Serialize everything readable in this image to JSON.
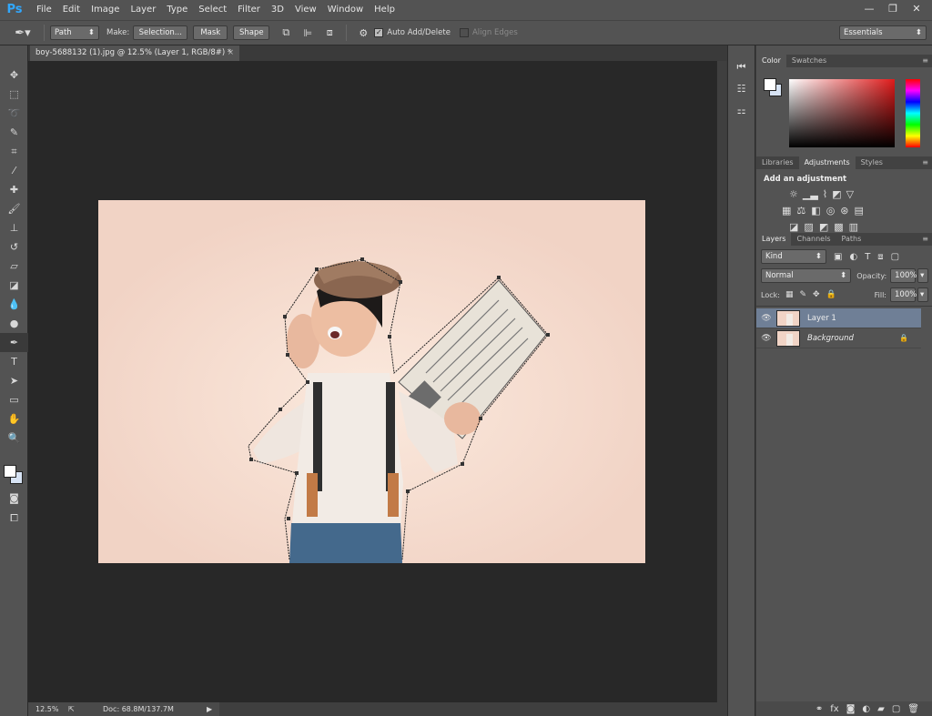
{
  "app": {
    "logo": "Ps"
  },
  "menu": [
    "File",
    "Edit",
    "Image",
    "Layer",
    "Type",
    "Select",
    "Filter",
    "3D",
    "View",
    "Window",
    "Help"
  ],
  "window_controls": [
    "—",
    "❐",
    "✕"
  ],
  "options": {
    "mode": "Path",
    "make_label": "Make:",
    "selection_btn": "Selection...",
    "mask_btn": "Mask",
    "shape_btn": "Shape",
    "auto_add_delete": "Auto Add/Delete",
    "align_edges": "Align Edges",
    "workspace": "Essentials"
  },
  "document": {
    "tab_title": "boy-5688132 (1).jpg @ 12.5% (Layer 1, RGB/8#) *",
    "zoom": "12.5%",
    "doc_size": "Doc: 68.8M/137.7M"
  },
  "color_panel": {
    "tabs": [
      "Color",
      "Swatches"
    ]
  },
  "adjust_panel": {
    "tabs": [
      "Libraries",
      "Adjustments",
      "Styles"
    ],
    "heading": "Add an adjustment"
  },
  "layers_panel": {
    "tabs": [
      "Layers",
      "Channels",
      "Paths"
    ],
    "kind": "Kind",
    "blend_mode": "Normal",
    "opacity_label": "Opacity:",
    "opacity": "100%",
    "lock_label": "Lock:",
    "fill_label": "Fill:",
    "fill": "100%",
    "layers": [
      {
        "name": "Layer 1",
        "selected": true
      },
      {
        "name": "Background",
        "selected": false
      }
    ],
    "footer_icons": [
      "link-icon",
      "fx-icon",
      "mask-icon",
      "adjustment-icon",
      "folder-icon",
      "new-layer-icon",
      "trash-icon"
    ]
  },
  "colors": {
    "accent": "#31a8ff",
    "selected_layer": "#6f7f96",
    "canvas_bg": "#282828",
    "photo_bg": "#f1d4c6"
  }
}
